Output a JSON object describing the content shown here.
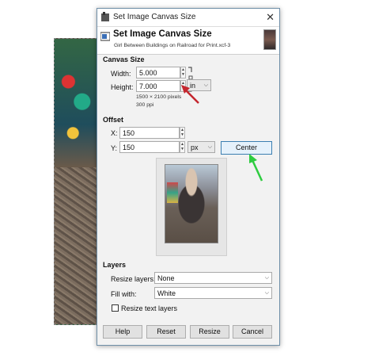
{
  "window": {
    "title": "Set Image Canvas Size",
    "close_glyph": "✕"
  },
  "header": {
    "title": "Set Image Canvas Size",
    "subtitle": "Girl Between Buildings on Railroad for Print.xcf-3"
  },
  "canvas_size": {
    "section_label": "Canvas Size",
    "width_label": "Width:",
    "width_value": "5.000",
    "height_label": "Height:",
    "height_value": "7.000",
    "unit": "in",
    "info_pixels": "1500 × 2100 pixels",
    "info_ppi": "300 ppi"
  },
  "offset": {
    "section_label": "Offset",
    "x_label": "X:",
    "x_value": "150",
    "y_label": "Y:",
    "y_value": "150",
    "unit": "px",
    "center_label": "Center"
  },
  "layers": {
    "section_label": "Layers",
    "resize_layers_label": "Resize layers:",
    "resize_layers_value": "None",
    "fill_with_label": "Fill with:",
    "fill_with_value": "White",
    "resize_text_layers_label": "Resize text layers",
    "resize_text_layers_checked": false
  },
  "buttons": {
    "help": "Help",
    "reset": "Reset",
    "resize": "Resize",
    "cancel": "Cancel"
  },
  "icons": {
    "chain": "chain-icon",
    "close": "close-icon",
    "dropdown": "chevron-down-icon"
  },
  "colors": {
    "annotation_red": "#c4262e",
    "annotation_green": "#2ecc40",
    "focus_blue": "#3c7fb1"
  }
}
